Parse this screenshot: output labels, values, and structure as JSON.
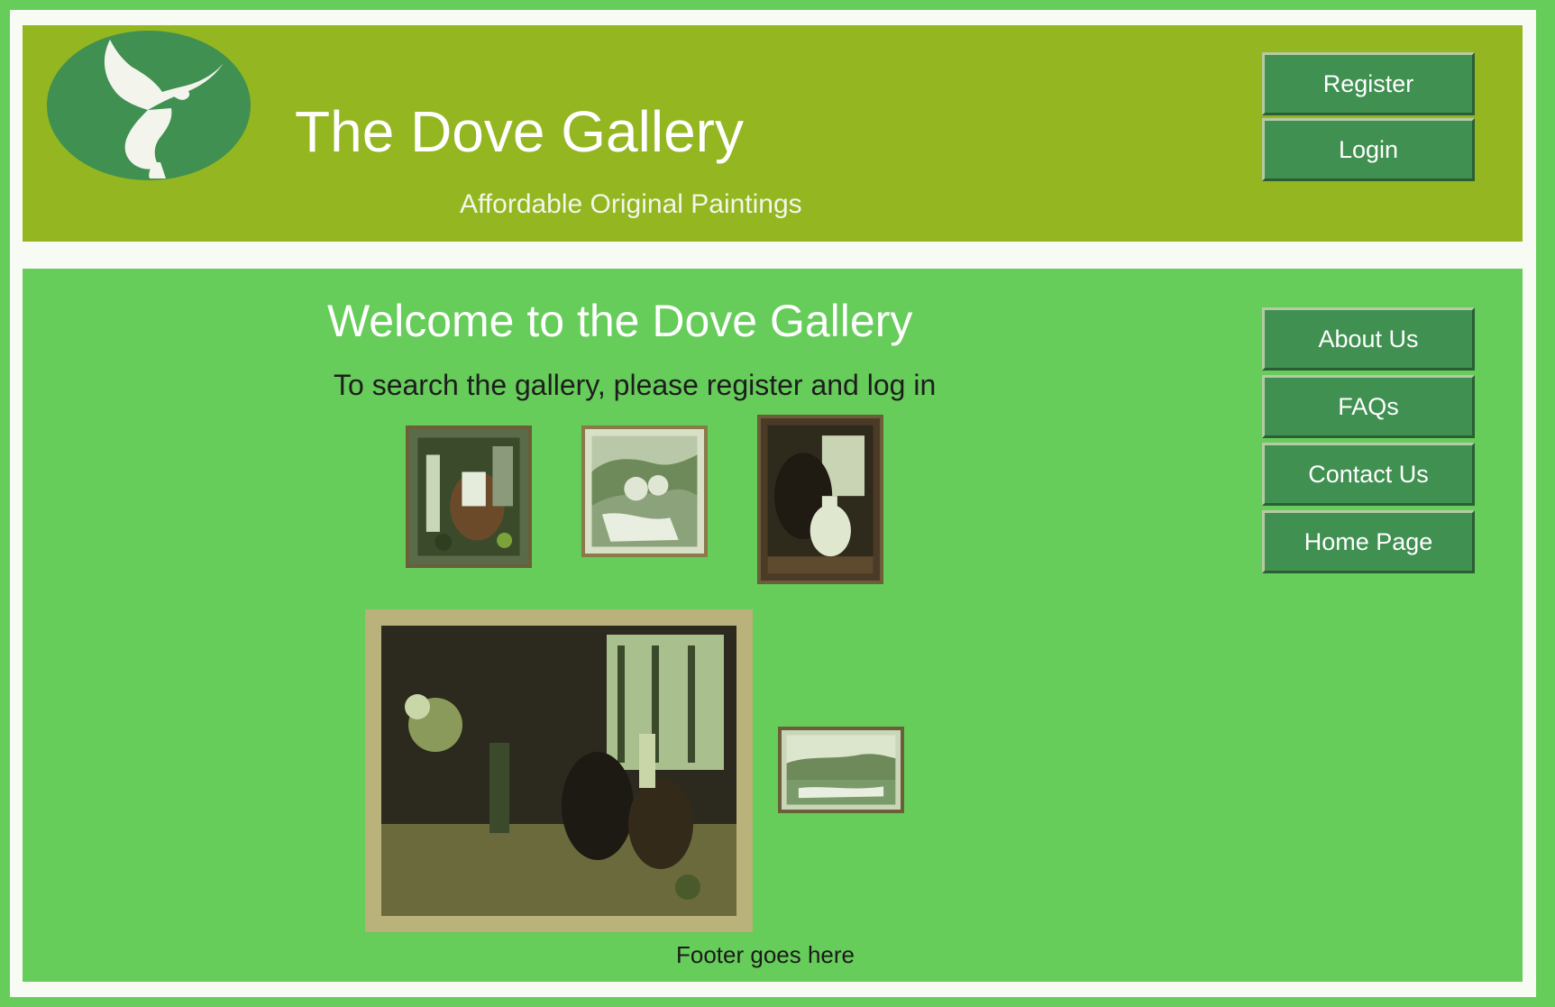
{
  "header": {
    "title": "The Dove Gallery",
    "tagline": "Affordable Original Paintings",
    "logo_icon": "dove-icon",
    "register_label": "Register",
    "login_label": "Login"
  },
  "main": {
    "welcome_heading": "Welcome to the Dove Gallery",
    "instruction": "To search the gallery, please register and log in",
    "footer_text": "Footer goes here"
  },
  "sidebar": {
    "items": [
      {
        "label": "About Us"
      },
      {
        "label": "FAQs"
      },
      {
        "label": "Contact Us"
      },
      {
        "label": "Home Page"
      }
    ]
  },
  "colors": {
    "outer_background": "#66cc5a",
    "header_background": "#93b621",
    "button_background": "#3f9051",
    "content_background": "#66cc5a"
  }
}
